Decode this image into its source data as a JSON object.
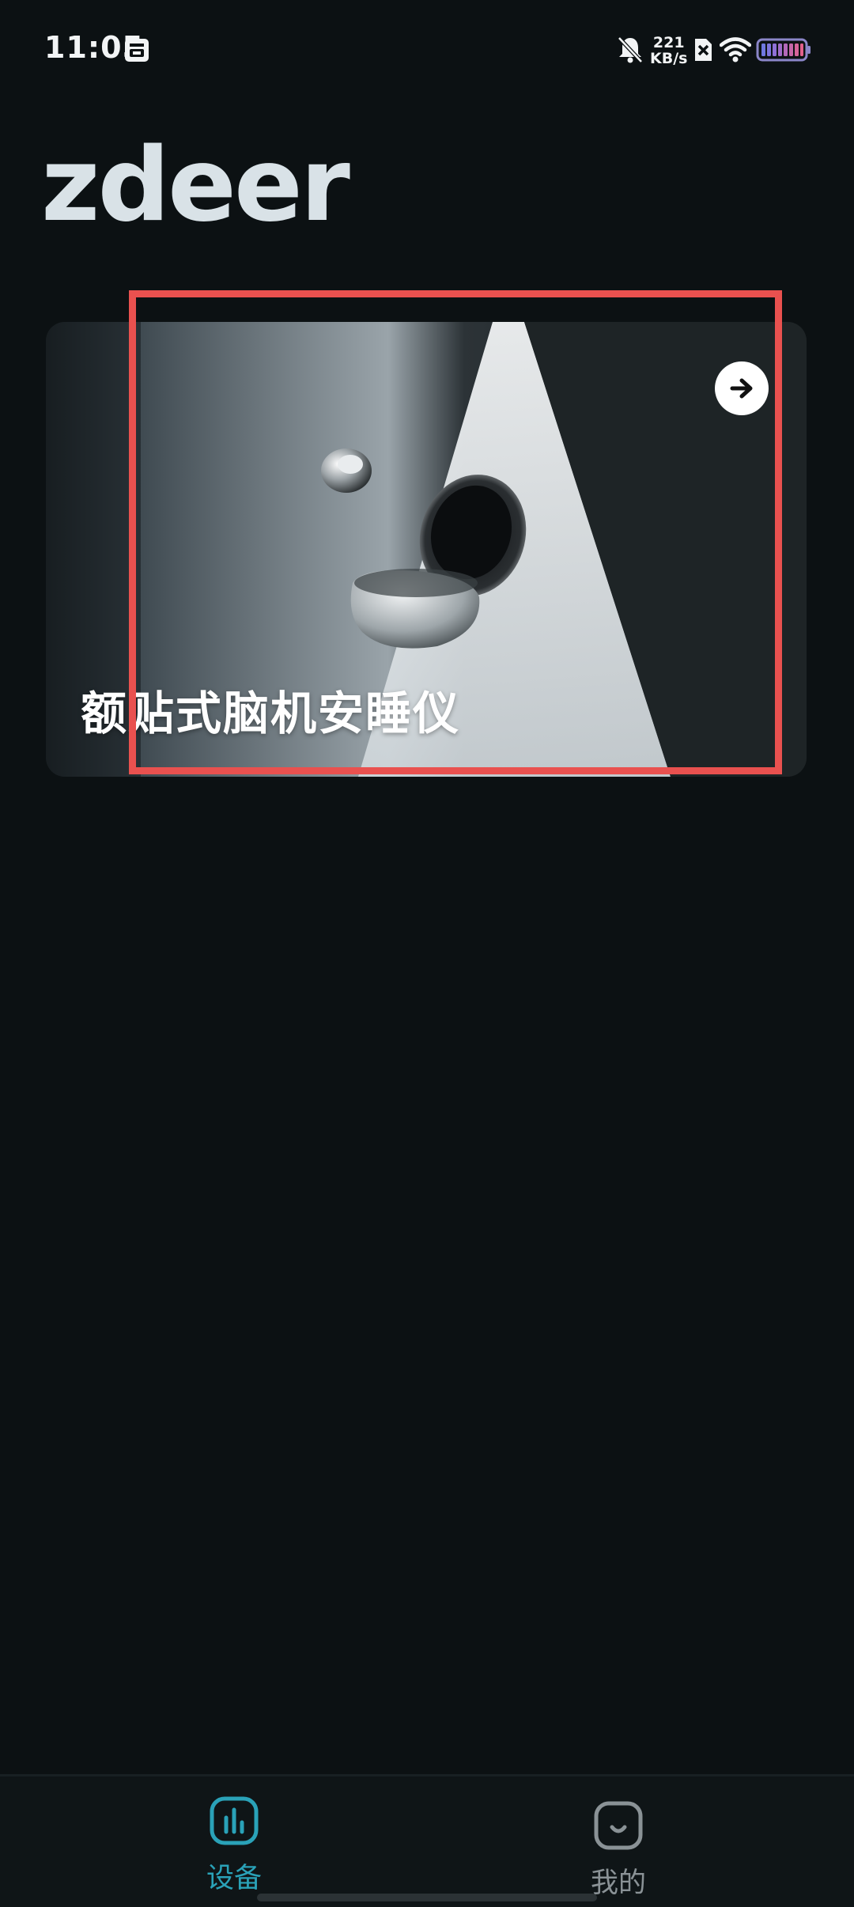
{
  "status_bar": {
    "time": "11:05",
    "net_speed_value": "221",
    "net_speed_unit": "KB/s",
    "icons": [
      "calendar-icon",
      "mute-bell-icon",
      "sim-icon",
      "wifi-icon",
      "battery-icon"
    ]
  },
  "brand": {
    "logo_text": "zdeer"
  },
  "device_card": {
    "title": "额贴式脑机安睡仪",
    "action_icon": "arrow-right-icon"
  },
  "bottom_nav": {
    "items": [
      {
        "label": "设备",
        "icon": "bar-chart-icon",
        "active": true
      },
      {
        "label": "我的",
        "icon": "smile-face-icon",
        "active": false
      }
    ]
  },
  "colors": {
    "background": "#0c1113",
    "accent": "#2aa2b8",
    "highlight": "#e9514f"
  }
}
